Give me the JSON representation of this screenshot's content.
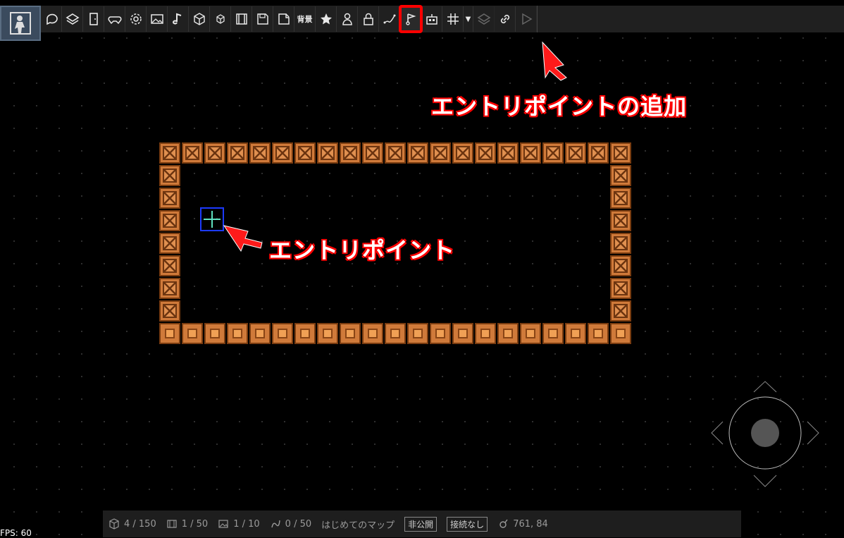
{
  "toolbar": {
    "buttons": [
      {
        "name": "chat"
      },
      {
        "name": "layers"
      },
      {
        "name": "door"
      },
      {
        "name": "gamepad"
      },
      {
        "name": "settings"
      },
      {
        "name": "image"
      },
      {
        "name": "music"
      },
      {
        "name": "cube"
      },
      {
        "name": "small-cube"
      },
      {
        "name": "film"
      },
      {
        "name": "save"
      },
      {
        "name": "export"
      },
      {
        "name": "background",
        "label": "背景"
      },
      {
        "name": "star"
      },
      {
        "name": "person"
      },
      {
        "name": "lock"
      },
      {
        "name": "path"
      },
      {
        "name": "flag",
        "highlighted": true
      },
      {
        "name": "robot"
      },
      {
        "name": "grid"
      },
      {
        "name": "dropdown",
        "label": "▼"
      },
      {
        "name": "layers-disabled"
      },
      {
        "name": "link"
      },
      {
        "name": "play"
      }
    ]
  },
  "annotations": {
    "add_entry_point": "エントリポイントの追加",
    "entry_point": "エントリポイント"
  },
  "status": {
    "objects": "4 / 150",
    "scenes": "1 / 50",
    "images": "1 / 10",
    "paths": "0 / 50",
    "map_name": "はじめてのマップ",
    "visibility": "非公開",
    "connection": "接続なし",
    "coords": "761, 84"
  },
  "fps": "FPS: 60",
  "colors": {
    "highlight": "#ff0000",
    "entry_point_border": "#1c3aff",
    "entry_point_cross": "#5fe0c0"
  }
}
